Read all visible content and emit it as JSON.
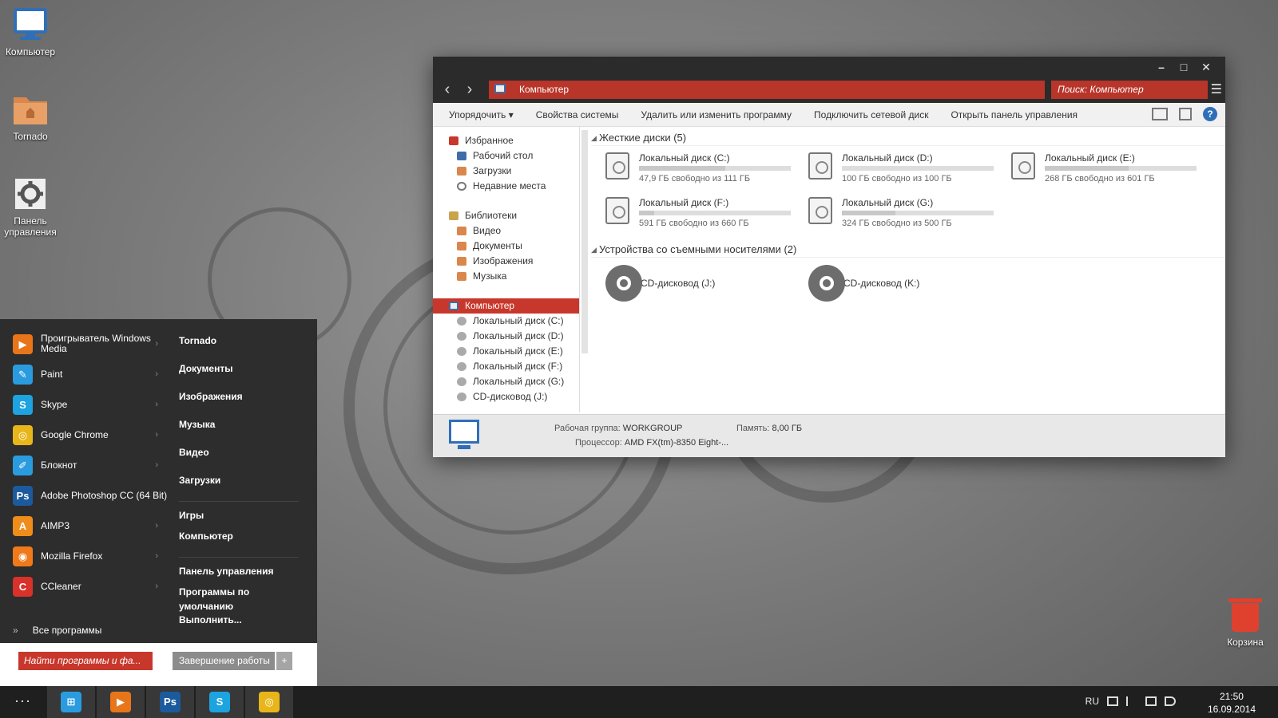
{
  "desktop": {
    "icons": [
      {
        "label": "Компьютер"
      },
      {
        "label": "Tornado"
      },
      {
        "label": "Панель управления"
      }
    ],
    "trash_label": "Корзина"
  },
  "explorer": {
    "address": "Компьютер",
    "search_placeholder": "Поиск: Компьютер",
    "toolbar": [
      "Упорядочить ▾",
      "Свойства системы",
      "Удалить или изменить программу",
      "Подключить сетевой диск",
      "Открыть панель управления"
    ],
    "nav": {
      "favorites": "Избранное",
      "favorites_items": [
        "Рабочий стол",
        "Загрузки",
        "Недавние места"
      ],
      "libraries": "Библиотеки",
      "libraries_items": [
        "Видео",
        "Документы",
        "Изображения",
        "Музыка"
      ],
      "computer": "Компьютер",
      "computer_items": [
        "Локальный диск (C:)",
        "Локальный диск (D:)",
        "Локальный диск (E:)",
        "Локальный диск (F:)",
        "Локальный диск (G:)",
        "CD-дисковод (J:)"
      ]
    },
    "hard_disks_header": "Жесткие диски (5)",
    "disks": [
      {
        "name": "Локальный диск (C:)",
        "free": "47,9 ГБ свободно из 111 ГБ",
        "used_fraction": 0.57
      },
      {
        "name": "Локальный диск (D:)",
        "free": "100 ГБ свободно из 100 ГБ",
        "used_fraction": 0.0
      },
      {
        "name": "Локальный диск (E:)",
        "free": "268 ГБ свободно из 601 ГБ",
        "used_fraction": 0.55
      },
      {
        "name": "Локальный диск (F:)",
        "free": "591 ГБ свободно из 660 ГБ",
        "used_fraction": 0.1
      },
      {
        "name": "Локальный диск (G:)",
        "free": "324 ГБ свободно из 500 ГБ",
        "used_fraction": 0.35
      }
    ],
    "removable_header": "Устройства со съемными носителями (2)",
    "cd_drives": [
      "CD-дисковод (J:)",
      "CD-дисковод (K:)"
    ],
    "details": {
      "workgroup_label": "Рабочая группа:",
      "workgroup": "WORKGROUP",
      "memory_label": "Память:",
      "memory": "8,00 ГБ",
      "cpu_label": "Процессор:",
      "cpu": "AMD FX(tm)-8350 Eight-..."
    }
  },
  "start_menu": {
    "apps": [
      {
        "name": "Проигрыватель Windows Media",
        "icon": "media-player-icon",
        "color": "#e8751a",
        "glyph": "▶"
      },
      {
        "name": "Paint",
        "icon": "paint-icon",
        "color": "#2b9be0",
        "glyph": "✎"
      },
      {
        "name": "Skype",
        "icon": "skype-icon",
        "color": "#1ca3e0",
        "glyph": "S"
      },
      {
        "name": "Google Chrome",
        "icon": "chrome-icon",
        "color": "#e8b61a",
        "glyph": "◎"
      },
      {
        "name": "Блокнот",
        "icon": "notepad-icon",
        "color": "#2b9be0",
        "glyph": "✐"
      },
      {
        "name": "Adobe Photoshop CC (64 Bit)",
        "icon": "photoshop-icon",
        "color": "#1c5a9e",
        "glyph": "Ps"
      },
      {
        "name": "AIMP3",
        "icon": "aimp-icon",
        "color": "#f08c1a",
        "glyph": "A"
      },
      {
        "name": "Mozilla Firefox",
        "icon": "firefox-icon",
        "color": "#f07a1a",
        "glyph": "◉"
      },
      {
        "name": "CCleaner",
        "icon": "ccleaner-icon",
        "color": "#d8322a",
        "glyph": "C"
      }
    ],
    "all_programs": "Все программы",
    "places": [
      "Tornado",
      "Документы",
      "Изображения",
      "Музыка",
      "Видео",
      "Загрузки",
      "Игры",
      "Компьютер",
      "Панель управления",
      "Программы по умолчанию",
      "Выполнить..."
    ],
    "search_placeholder": "Найти программы и фа...",
    "shutdown_label": "Завершение работы",
    "shutdown_arrow": "+"
  },
  "taskbar": {
    "menu_dots": "···",
    "language": "RU",
    "time": "21:50",
    "date": "16.09.2014"
  },
  "colors": {
    "accent": "#c8372b",
    "window_chrome": "#2b2b2b",
    "start_bg": "#2d2d2d"
  }
}
